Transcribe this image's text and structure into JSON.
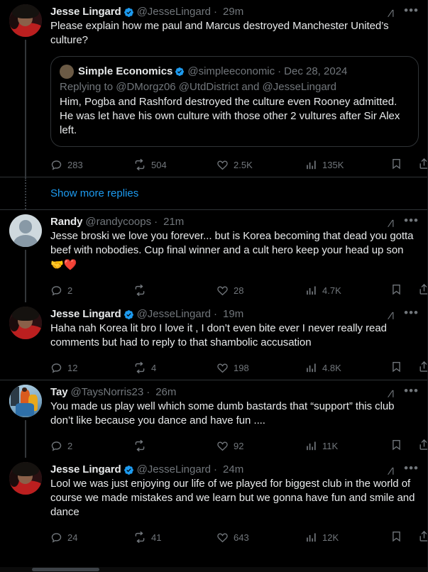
{
  "app": {
    "platform": "X (Twitter)",
    "theme": "dark",
    "accent_blue": "#1d9bf0",
    "verified_blue": "#1d9bf0",
    "text_primary": "#e7e9ea",
    "text_secondary": "#71767b",
    "divider": "#2f3336",
    "background": "#000000"
  },
  "show_more": {
    "label": "Show more replies"
  },
  "icons": {
    "grok": "grok-icon",
    "more": "•••",
    "reply": "reply-icon",
    "retweet": "retweet-icon",
    "like": "like-icon",
    "views": "views-icon",
    "bookmark": "bookmark-icon",
    "share": "share-icon"
  },
  "tweets": [
    {
      "id": "t1",
      "author": "Jesse Lingard",
      "verified": true,
      "handle": "@JesseLingard",
      "time": "29m",
      "avatar": "jesse-lingard-avatar",
      "text": "Please explain how me paul and Marcus destroyed Manchester United’s culture?",
      "quote": {
        "author": "Simple Economics",
        "verified": true,
        "handle": "@simpleeconomic",
        "date": "Dec 28, 2024",
        "avatar": "simple-economics-avatar",
        "replying_to": "Replying to @DMorgz06 @UtdDistrict and @JesseLingard",
        "text": "Him, Pogba and Rashford destroyed the culture even Rooney admitted. He was let have his own culture with those other 2 vultures after Sir Alex left."
      },
      "stats": {
        "replies": "283",
        "retweets": "504",
        "likes": "2.5K",
        "views": "135K"
      }
    },
    {
      "id": "t2",
      "author": "Randy",
      "verified": false,
      "handle": "@randycoops",
      "time": "21m",
      "avatar": "default-avatar",
      "text": "Jesse broski we love you forever... but is Korea becoming that dead you gotta beef with nobodies. Cup final winner and a cult hero keep your head up son ",
      "emoji": "🤝❤️",
      "stats": {
        "replies": "2",
        "retweets": "",
        "likes": "28",
        "views": "4.7K"
      }
    },
    {
      "id": "t3",
      "author": "Jesse Lingard",
      "verified": true,
      "handle": "@JesseLingard",
      "time": "19m",
      "avatar": "jesse-lingard-avatar",
      "text": "Haha nah Korea lit bro I love it , I don’t even bite ever I never really read comments but had to reply to that shambolic accusation",
      "stats": {
        "replies": "12",
        "retweets": "4",
        "likes": "198",
        "views": "4.8K"
      }
    },
    {
      "id": "t4",
      "author": "Tay",
      "verified": false,
      "handle": "@TaysNorris23",
      "time": "26m",
      "avatar": "tay-avatar",
      "text": "You made us play well which some dumb bastards that “support” this club don’t like because you dance and have fun ....",
      "stats": {
        "replies": "2",
        "retweets": "",
        "likes": "92",
        "views": "11K"
      }
    },
    {
      "id": "t5",
      "author": "Jesse Lingard",
      "verified": true,
      "handle": "@JesseLingard",
      "time": "24m",
      "avatar": "jesse-lingard-avatar",
      "text": "Lool we was just enjoying our life of we played for biggest club in the world of course we made mistakes and we learn but we gonna have fun and smile and dance",
      "stats": {
        "replies": "24",
        "retweets": "41",
        "likes": "643",
        "views": "12K"
      }
    }
  ]
}
